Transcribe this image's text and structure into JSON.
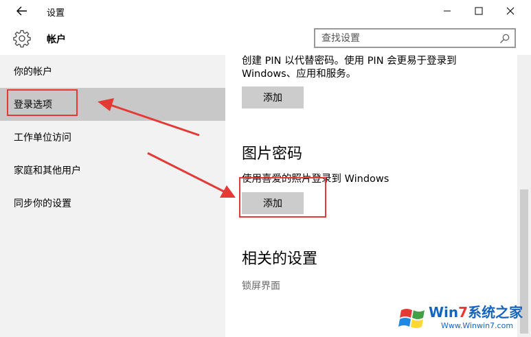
{
  "window": {
    "title": "设置"
  },
  "header": {
    "section_title": "帐户",
    "search_placeholder": "查找设置"
  },
  "sidebar": {
    "items": [
      {
        "label": "你的帐户"
      },
      {
        "label": "登录选项",
        "selected": true
      },
      {
        "label": "工作单位访问"
      },
      {
        "label": "家庭和其他用户"
      },
      {
        "label": "同步你的设置"
      }
    ]
  },
  "content": {
    "pin": {
      "description_line1": "创建 PIN 以代替密码。使用 PIN 会更易于登录到",
      "description_line2": "Windows、应用和服务。",
      "add_label": "添加"
    },
    "picture_password": {
      "heading": "图片密码",
      "description": "使用喜爱的照片登录到 Windows",
      "add_label": "添加"
    },
    "related": {
      "heading": "相关的设置",
      "link_lock_screen": "锁屏界面"
    }
  },
  "watermark": {
    "brand_prefix": "Win",
    "brand_seven": "7",
    "brand_suffix": "系统之家",
    "url": "Www.Winwin7.com"
  },
  "colors": {
    "sidebar_bg": "#f2f2f2",
    "selected_bg": "#c8c8c8",
    "button_bg": "#cccccc",
    "annotation": "#e53935"
  }
}
